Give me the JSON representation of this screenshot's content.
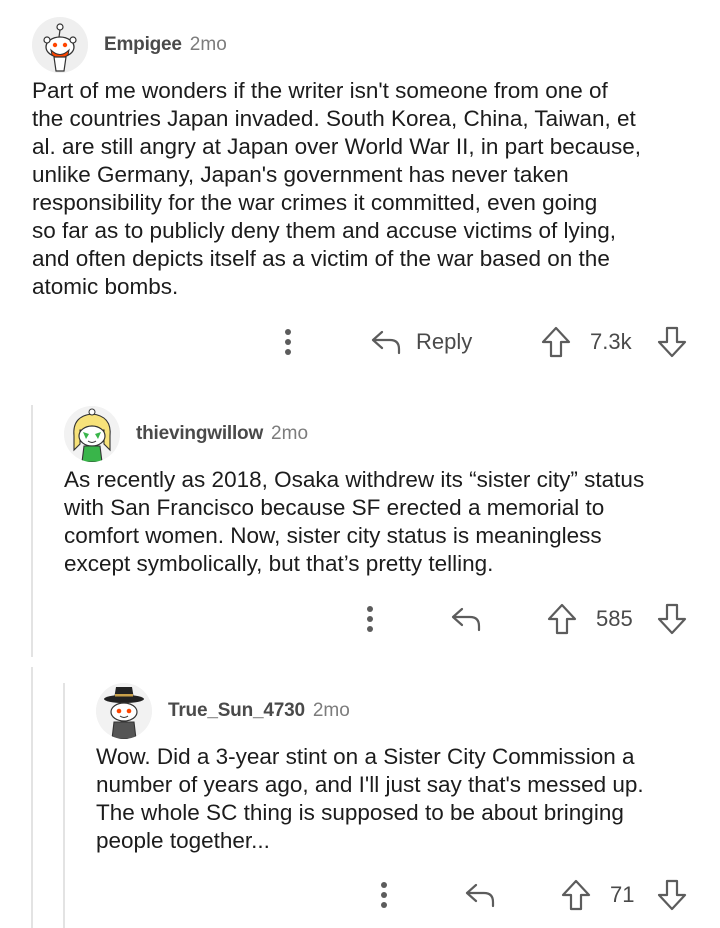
{
  "comments": [
    {
      "username": "Empigee",
      "age": "2mo",
      "body": "Part of me wonders if the writer isn't someone from one of\nthe countries Japan invaded. South Korea, China, Taiwan, et\nal. are still angry at Japan over World War II, in part because,\nunlike Germany, Japan's government has never taken\nresponsibility for the war crimes it committed, even going\nso far as to publicly deny them and accuse victims of lying,\nand often depicts itself as a victim of the war based on the\natomic bombs.",
      "reply_label": "Reply",
      "score": "7.3k",
      "avatar": "snoo-red-mask-avatar"
    },
    {
      "username": "thievingwillow",
      "age": "2mo",
      "body": "As recently as 2018, Osaka withdrew its “sister city” status\nwith San Francisco because SF erected a memorial to\ncomfort women. Now, sister city status is meaningless\nexcept symbolically, but that’s pretty telling.",
      "score": "585",
      "avatar": "snoo-blonde-green-avatar"
    },
    {
      "username": "True_Sun_4730",
      "age": "2mo",
      "body": "Wow.  Did a 3-year stint on a Sister City Commission a\nnumber of years ago, and I'll just say that's messed up.\nThe whole SC thing is supposed to be about bringing\npeople together...",
      "score": "71",
      "avatar": "snoo-black-hat-avatar"
    }
  ],
  "colors": {
    "text": "#1c1c1c",
    "meta": "#7c7c7c",
    "icon": "#5c5c5c",
    "thread_line": "#e3e3e3",
    "accent_orange": "#ff4500"
  },
  "icons": [
    "more-options-icon",
    "reply-icon",
    "upvote-icon",
    "downvote-icon"
  ]
}
